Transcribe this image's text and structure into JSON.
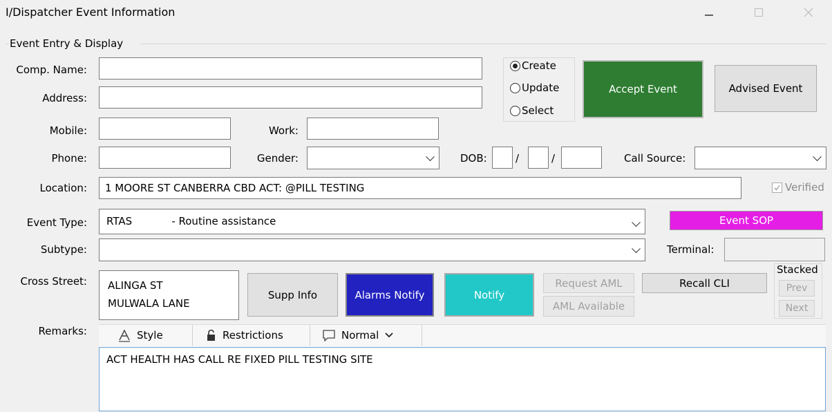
{
  "window": {
    "title": "I/Dispatcher Event Information"
  },
  "group_title": "Event Entry & Display",
  "labels": {
    "comp_name": "Comp. Name:",
    "address": "Address:",
    "mobile": "Mobile:",
    "work": "Work:",
    "phone": "Phone:",
    "gender": "Gender:",
    "dob": "DOB:",
    "call_source": "Call Source:",
    "location": "Location:",
    "event_type": "Event Type:",
    "subtype": "Subtype:",
    "terminal": "Terminal:",
    "cross_street": "Cross Street:",
    "remarks": "Remarks:",
    "stacked": "Stacked",
    "verified": "Verified",
    "dob_sep": "/"
  },
  "fields": {
    "comp_name": "",
    "address": "",
    "mobile": "",
    "work": "",
    "phone": "",
    "gender": "",
    "dob_day": "",
    "dob_month": "",
    "dob_year": "",
    "call_source": "",
    "location": "1 MOORE ST CANBERRA CBD ACT: @PILL TESTING",
    "event_type": "RTAS            - Routine assistance",
    "subtype": "",
    "terminal": "",
    "cross_street_1": "ALINGA ST",
    "cross_street_2": "MULWALA LANE",
    "remarks": "ACT HEALTH HAS CALL RE FIXED PILL TESTING SITE"
  },
  "mode": {
    "options": [
      "Create",
      "Update",
      "Select"
    ],
    "selected": "Create"
  },
  "buttons": {
    "accept_event": "Accept Event",
    "advised_event": "Advised Event",
    "event_sop": "Event SOP",
    "supp_info": "Supp Info",
    "alarms_notify": "Alarms Notify",
    "notify": "Notify",
    "request_aml": "Request AML",
    "aml_available": "AML Available",
    "recall_cli": "Recall CLI",
    "prev": "Prev",
    "next": "Next"
  },
  "remarks_toolbar": {
    "style": "Style",
    "restrictions": "Restrictions",
    "normal": "Normal"
  },
  "colors": {
    "accept": "#2e7d32",
    "sop": "#e51ee5",
    "alarms": "#2222c0",
    "notify": "#22c8c8"
  }
}
